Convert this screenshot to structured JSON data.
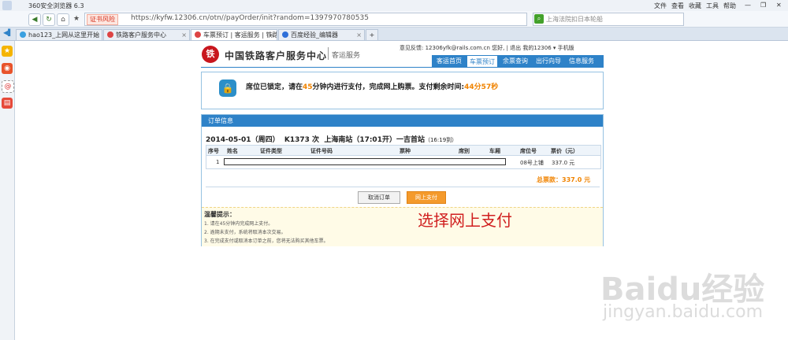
{
  "browser": {
    "title": "360安全浏览器 6.3",
    "menu": [
      "文件",
      "查看",
      "收藏",
      "工具",
      "帮助"
    ],
    "cert_badge": "证书风险",
    "url": "https://kyfw.12306.cn/otn//payOrder/init?random=1397970780535",
    "search_text": "上海法院扣日本轮船",
    "tabs": [
      {
        "label": "hao123_上网从这里开始"
      },
      {
        "label": "铁路客户服务中心"
      },
      {
        "label": "车票预订 | 客运服务 | 铁路客户服务中心"
      },
      {
        "label": "百度经验_编辑器"
      }
    ]
  },
  "site": {
    "logo_glyph": "铁",
    "name": "中国铁路客户服务中心",
    "sub": "客运服务",
    "header_info": "意见反馈: 12306yfk@rails.com.cn   您好,       | 退出      我的12306 ▾      手机版",
    "nav": [
      "客运首页",
      "车票预订",
      "余票查询",
      "出行向导",
      "信息服务"
    ]
  },
  "lock": {
    "prefix": "席位已锁定，请在",
    "minutes": "45",
    "middle": "分钟内进行支付，完成网上购票。支付剩余时间:",
    "remaining": "44分57秒"
  },
  "order": {
    "header": "订单信息",
    "date": "2014-05-01（周四）",
    "train": "K1373 次",
    "route": "上海南站（17:01开）一吉首站",
    "arrive": "（16:19到）",
    "columns": [
      "序号",
      "姓名",
      "证件类型",
      "证件号码",
      "票种",
      "席别",
      "车厢",
      "席位号",
      "票价（元）"
    ],
    "row": {
      "index": "1",
      "seat": "08号上铺",
      "price": "337.0 元"
    },
    "total": "总票款：337.0 元",
    "cancel": "取消订单",
    "pay": "网上支付"
  },
  "tips": {
    "title": "温馨提示：",
    "items": [
      "1.  请在45分钟内完成网上支付。",
      "2.  逾期未支付，系统将取消本次交易。",
      "3.  在完成支付或取消本订单之前，您将无法购买其他车票。"
    ]
  },
  "caption": "选择网上支付",
  "watermark": {
    "main": "Baidu经验",
    "sub": "jingyan.baidu.com"
  },
  "colors": {
    "accent": "#2e82c8",
    "orange": "#f08300",
    "caption": "#d01f1f"
  }
}
